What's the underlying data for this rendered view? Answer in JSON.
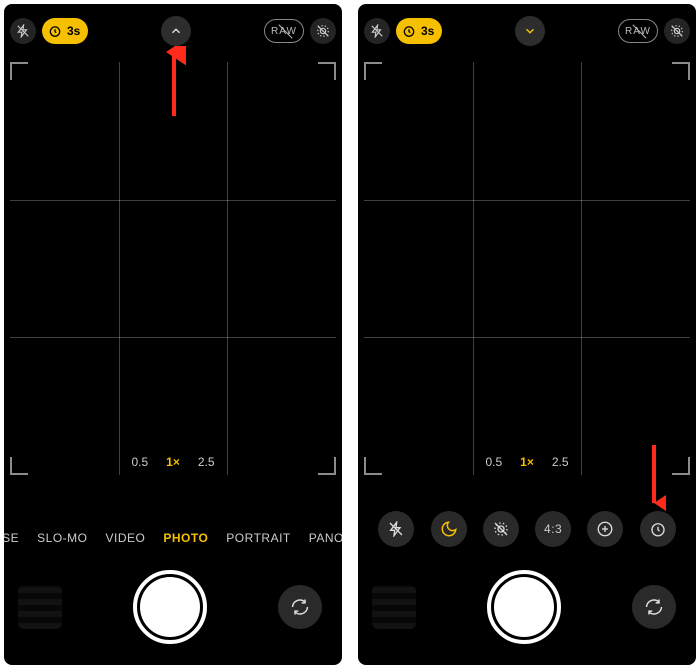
{
  "phones": {
    "left": {
      "timer_label": "3s",
      "raw_label": "RAW",
      "chevron_dir": "up",
      "zoom": {
        "wide": "0.5",
        "main": "1×",
        "tele": "2.5",
        "active": "main"
      },
      "modes": {
        "items": [
          "SE",
          "SLO-MO",
          "VIDEO",
          "PHOTO",
          "PORTRAIT",
          "PANO"
        ],
        "active": "PHOTO"
      }
    },
    "right": {
      "timer_label": "3s",
      "raw_label": "RAW",
      "chevron_dir": "down",
      "zoom": {
        "wide": "0.5",
        "main": "1×",
        "tele": "2.5",
        "active": "main"
      },
      "tools": {
        "aspect_label": "4:3"
      }
    }
  },
  "annotation": {
    "arrow_color": "#ff2a1a"
  }
}
